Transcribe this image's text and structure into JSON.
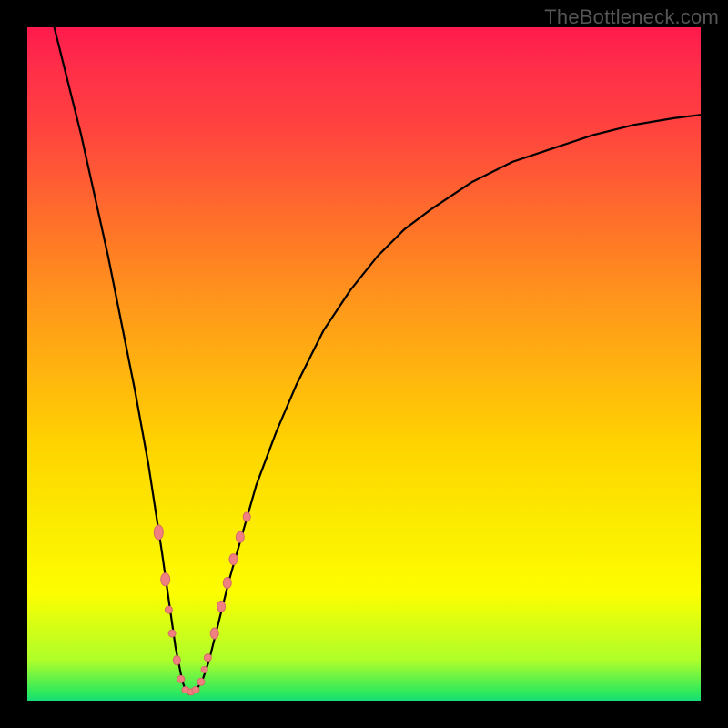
{
  "watermark": "TheBottleneck.com",
  "chart_data": {
    "type": "line",
    "title": "",
    "xlabel": "",
    "ylabel": "",
    "xlim": [
      0,
      100
    ],
    "ylim": [
      0,
      100
    ],
    "series": [
      {
        "name": "bottleneck-curve",
        "x": [
          4,
          6,
          8,
          10,
          12,
          14,
          16,
          18,
          20,
          21,
          22,
          23,
          23.5,
          24,
          25,
          26,
          27,
          28,
          30,
          32,
          34,
          37,
          40,
          44,
          48,
          52,
          56,
          60,
          66,
          72,
          78,
          84,
          90,
          96,
          100
        ],
        "y": [
          100,
          92,
          84,
          75,
          66,
          56,
          46,
          35,
          22,
          15,
          8,
          3,
          1.5,
          1,
          1.5,
          3,
          6,
          10,
          18,
          25,
          32,
          40,
          47,
          55,
          61,
          66,
          70,
          73,
          77,
          80,
          82,
          84,
          85.5,
          86.5,
          87
        ]
      }
    ],
    "beads": {
      "name": "data-beads",
      "points": [
        {
          "x": 19.5,
          "y": 25,
          "rx": 5,
          "ry": 8
        },
        {
          "x": 20.5,
          "y": 18,
          "rx": 5,
          "ry": 7
        },
        {
          "x": 21.0,
          "y": 13.5,
          "rx": 4,
          "ry": 4
        },
        {
          "x": 21.5,
          "y": 10,
          "rx": 4,
          "ry": 4
        },
        {
          "x": 22.2,
          "y": 6,
          "rx": 4,
          "ry": 5
        },
        {
          "x": 22.8,
          "y": 3.2,
          "rx": 4,
          "ry": 4
        },
        {
          "x": 23.5,
          "y": 1.6,
          "rx": 4,
          "ry": 3.5
        },
        {
          "x": 24.3,
          "y": 1.3,
          "rx": 4,
          "ry": 3.5
        },
        {
          "x": 25.0,
          "y": 1.6,
          "rx": 4,
          "ry": 3.5
        },
        {
          "x": 25.8,
          "y": 2.8,
          "rx": 4,
          "ry": 4
        },
        {
          "x": 26.3,
          "y": 4.6,
          "rx": 3.5,
          "ry": 3.5
        },
        {
          "x": 26.8,
          "y": 6.4,
          "rx": 4,
          "ry": 4
        },
        {
          "x": 27.8,
          "y": 10,
          "rx": 4.5,
          "ry": 6
        },
        {
          "x": 28.8,
          "y": 14,
          "rx": 4.5,
          "ry": 6
        },
        {
          "x": 29.7,
          "y": 17.5,
          "rx": 4.5,
          "ry": 6
        },
        {
          "x": 30.6,
          "y": 21,
          "rx": 4.5,
          "ry": 6
        },
        {
          "x": 31.6,
          "y": 24.3,
          "rx": 4.5,
          "ry": 6
        },
        {
          "x": 32.6,
          "y": 27.3,
          "rx": 4,
          "ry": 5
        }
      ]
    },
    "gradient_colors": {
      "top": "#ff1a4d",
      "mid": "#ffd300",
      "bottom": "#18db78"
    }
  }
}
